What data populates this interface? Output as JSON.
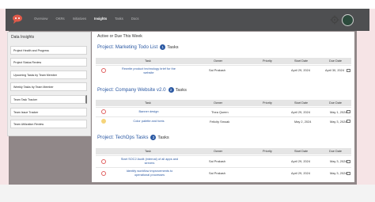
{
  "nav": {
    "items": [
      "Overview",
      "OKRs",
      "Initiatives",
      "Insights",
      "Tasks",
      "Docs"
    ],
    "active_index": 3
  },
  "sidebar": {
    "title": "Data Insights",
    "items": [
      "Project Health and Progress",
      "Project Status Review",
      "Upcoming Tasks by Team Member",
      "Weekly Tasks by Team Member",
      "Team Task Tracker",
      "Team Issue Tracker",
      "Team Utilization Review"
    ],
    "selected_index": 4
  },
  "main": {
    "title": "Active or Due This Week",
    "columns": [
      "Task",
      "Owner",
      "Priority",
      "Start Date",
      "Due Date"
    ],
    "tasks_label": "Tasks",
    "projects": [
      {
        "name": "Project: Marketing Todo List",
        "count": "1",
        "rows": [
          {
            "status": "red",
            "task": "Rewrite product technology brief for the website",
            "owner": "Sai Prakash",
            "priority": "",
            "start": "April 29, 2024",
            "due": "April 30, 2024"
          }
        ]
      },
      {
        "name": "Project: Company Website v2.0",
        "count": "2",
        "rows": [
          {
            "status": "red",
            "task": "Banner design",
            "owner": "Thea Queen",
            "priority": "",
            "start": "April 29, 2024",
            "due": "May 1, 2024"
          },
          {
            "status": "yellow",
            "task": "Color palette and fonts",
            "owner": "Felicity Smoak",
            "priority": "",
            "start": "May 2, 2024",
            "due": "May 3, 2024"
          }
        ]
      },
      {
        "name": "Project: TechOps Tasks",
        "count": "2",
        "rows": [
          {
            "status": "red",
            "task": "Start SOC2 Audit (internal) of all apps and servers",
            "owner": "Sai Prakash",
            "priority": "",
            "start": "April 29, 2024",
            "due": "May 3, 2024"
          },
          {
            "status": "red",
            "task": "Identify workflow improvements to operational processes",
            "owner": "Sai Prakash",
            "priority": "",
            "start": "April 29, 2024",
            "due": "May 3, 2024"
          }
        ]
      }
    ]
  },
  "colors": {
    "topbar": "#4e4f51",
    "link": "#2b59a3",
    "status_red": "#e06060",
    "status_yellow": "#f5d47a",
    "background_tint": "#f6e4e6"
  }
}
